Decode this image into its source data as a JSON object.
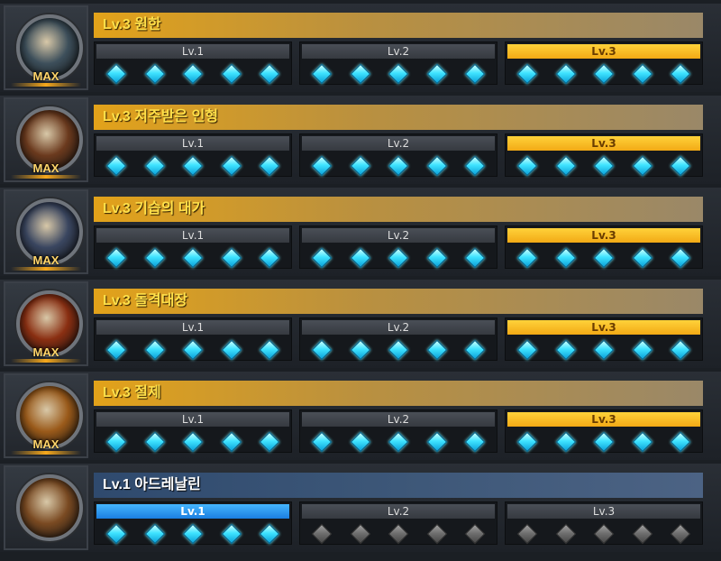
{
  "rows": [
    {
      "title": "Lv.3 원한",
      "max_label": "MAX",
      "theme": "gold",
      "orb_color": "#3d4f5b",
      "icon": "werewolf-portrait-icon",
      "levels": [
        {
          "label": "Lv.1",
          "active": false,
          "gems_on": 5
        },
        {
          "label": "Lv.2",
          "active": false,
          "gems_on": 5
        },
        {
          "label": "Lv.3",
          "active": true,
          "gems_on": 5
        }
      ]
    },
    {
      "title": "Lv.3 저주받은 인형",
      "max_label": "MAX",
      "theme": "gold",
      "orb_color": "#6b3a1e",
      "icon": "cursed-doll-portrait-icon",
      "levels": [
        {
          "label": "Lv.1",
          "active": false,
          "gems_on": 5
        },
        {
          "label": "Lv.2",
          "active": false,
          "gems_on": 5
        },
        {
          "label": "Lv.3",
          "active": true,
          "gems_on": 5
        }
      ]
    },
    {
      "title": "Lv.3 기습의 대가",
      "max_label": "MAX",
      "theme": "gold",
      "orb_color": "#3a4660",
      "icon": "ambush-portrait-icon",
      "levels": [
        {
          "label": "Lv.1",
          "active": false,
          "gems_on": 5
        },
        {
          "label": "Lv.2",
          "active": false,
          "gems_on": 5
        },
        {
          "label": "Lv.3",
          "active": true,
          "gems_on": 5
        }
      ]
    },
    {
      "title": "Lv.3 돌격대장",
      "max_label": "MAX",
      "theme": "gold",
      "orb_color": "#8a2f12",
      "icon": "charge-captain-portrait-icon",
      "levels": [
        {
          "label": "Lv.1",
          "active": false,
          "gems_on": 5
        },
        {
          "label": "Lv.2",
          "active": false,
          "gems_on": 5
        },
        {
          "label": "Lv.3",
          "active": true,
          "gems_on": 5
        }
      ]
    },
    {
      "title": "Lv.3 절제",
      "max_label": "MAX",
      "theme": "gold",
      "orb_color": "#9a5a1a",
      "icon": "restraint-portrait-icon",
      "levels": [
        {
          "label": "Lv.1",
          "active": false,
          "gems_on": 5
        },
        {
          "label": "Lv.2",
          "active": false,
          "gems_on": 5
        },
        {
          "label": "Lv.3",
          "active": true,
          "gems_on": 5
        }
      ]
    },
    {
      "title": "Lv.1 아드레날린",
      "max_label": "",
      "theme": "blue",
      "orb_color": "#7a4a22",
      "icon": "adrenaline-portrait-icon",
      "levels": [
        {
          "label": "Lv.1",
          "active": true,
          "gems_on": 5
        },
        {
          "label": "Lv.2",
          "active": false,
          "gems_on": 0
        },
        {
          "label": "Lv.3",
          "active": false,
          "gems_on": 0
        }
      ]
    }
  ]
}
